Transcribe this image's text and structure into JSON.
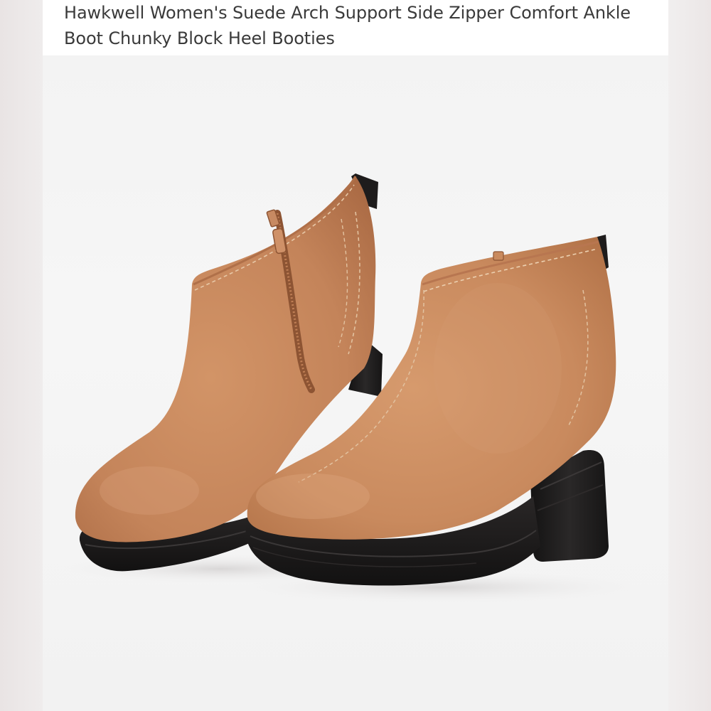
{
  "listing": {
    "title": "Hawkwell Women's Suede Arch Support Side Zipper Comfort Ankle Boot Chunky Block Heel Booties"
  },
  "image": {
    "subject_icon": "ankle-boot-icon",
    "colors": {
      "suede": "#c98a5e",
      "suede_shadow": "#a86842",
      "sole": "#1d1b1b",
      "background": "#f4f4f4"
    }
  }
}
